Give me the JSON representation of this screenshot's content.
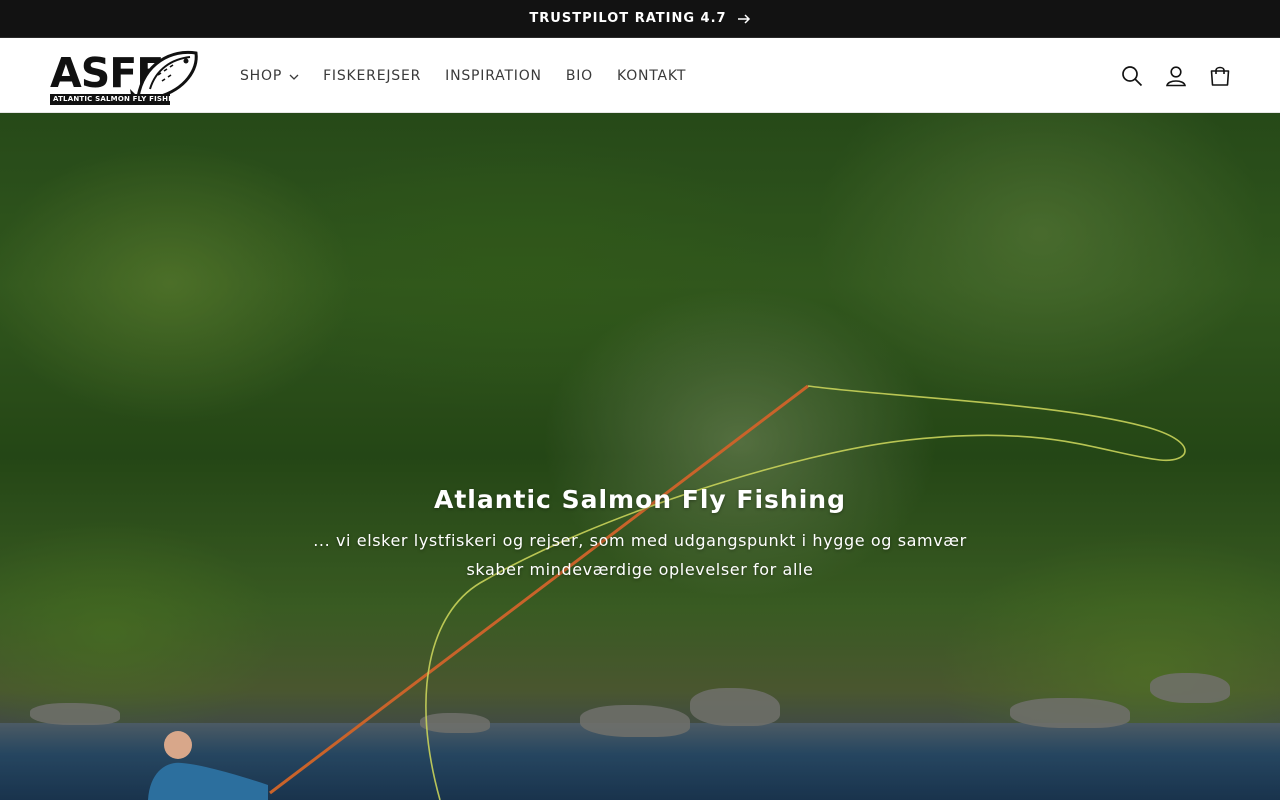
{
  "announcement": {
    "text": "TRUSTPILOT RATING 4.7",
    "icon": "arrow-right-icon"
  },
  "brand": {
    "logo_text": "ASFF",
    "logo_subtitle": "ATLANTIC SALMON FLY FISHING",
    "logo_icon": "salmon-fish-icon"
  },
  "nav": {
    "items": [
      {
        "label": "SHOP",
        "has_dropdown": true
      },
      {
        "label": "FISKEREJSER"
      },
      {
        "label": "INSPIRATION"
      },
      {
        "label": "BIO"
      },
      {
        "label": "KONTAKT"
      }
    ]
  },
  "header_icons": [
    "search-icon",
    "account-icon",
    "cart-icon"
  ],
  "hero": {
    "title": "Atlantic Salmon Fly Fishing",
    "subtitle_line1": "... vi elsker lystfiskeri og rejser, som med udgangspunkt i hygge og samvær",
    "subtitle_line2": "skaber mindeværdige oplevelser for alle"
  },
  "colors": {
    "announcement_bg": "#121212",
    "header_bg": "#ffffff",
    "text_dark": "#121212",
    "hero_text": "#ffffff",
    "line_green": "#c9d35a",
    "rod_orange": "#c9632a"
  }
}
